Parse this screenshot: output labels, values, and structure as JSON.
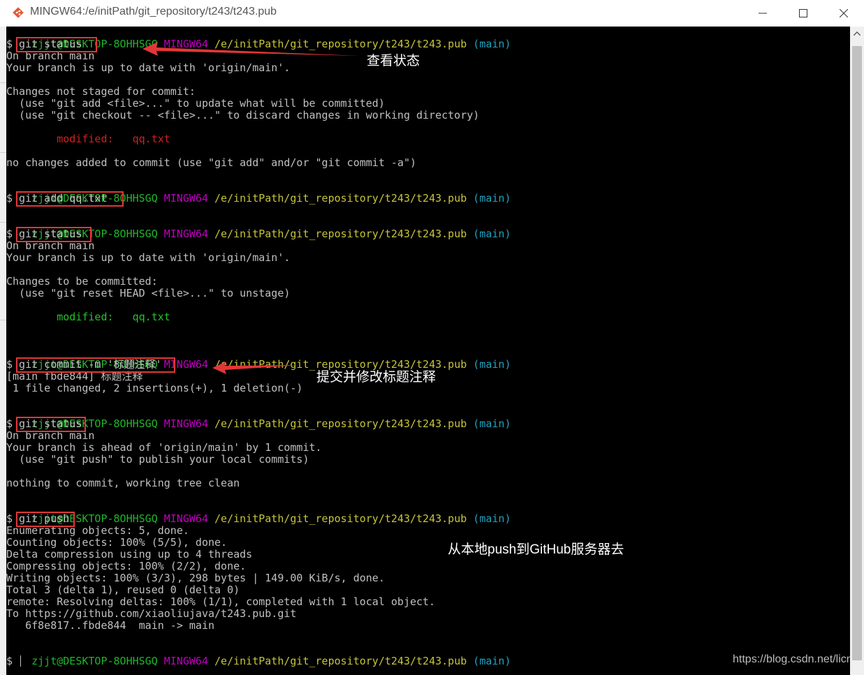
{
  "window": {
    "title": "MINGW64:/e/initPath/git_repository/t243/t243.pub",
    "buttons": [
      "minimize",
      "maximize",
      "close"
    ]
  },
  "prompt": {
    "user_host": "zjjt@DESKTOP-8OHHSGQ",
    "shell": "MINGW64",
    "path": "/e/initPath/git_repository/t243/t243.pub",
    "branch": "(main)"
  },
  "terminal": {
    "cmd1": "$ git status",
    "out1": [
      "On branch main",
      "Your branch is up to date with 'origin/main'.",
      "",
      "Changes not staged for commit:",
      "  (use \"git add <file>...\" to update what will be committed)",
      "  (use \"git checkout -- <file>...\" to discard changes in working directory)",
      ""
    ],
    "mod1_label": "        modified:   ",
    "mod1_file": "qq.txt",
    "out1b": "no changes added to commit (use \"git add\" and/or \"git commit -a\")",
    "cmd2": "$ git add qq.txt",
    "cmd3": "$ git status",
    "out3": [
      "On branch main",
      "Your branch is up to date with 'origin/main'.",
      "",
      "Changes to be committed:",
      "  (use \"git reset HEAD <file>...\" to unstage)"
    ],
    "mod3_label": "        modified:   ",
    "mod3_file": "qq.txt",
    "cmd4": "$ git commit -m '标题注释'",
    "out4": [
      "[main fbde844] 标题注释",
      " 1 file changed, 2 insertions(+), 1 deletion(-)"
    ],
    "cmd5": "$ git status",
    "out5": [
      "On branch main",
      "Your branch is ahead of 'origin/main' by 1 commit.",
      "  (use \"git push\" to publish your local commits)",
      "",
      "nothing to commit, working tree clean"
    ],
    "cmd6": "$ git push",
    "out6": [
      "Enumerating objects: 5, done.",
      "Counting objects: 100% (5/5), done.",
      "Delta compression using up to 4 threads",
      "Compressing objects: 100% (2/2), done.",
      "Writing objects: 100% (3/3), 298 bytes | 149.00 KiB/s, done.",
      "Total 3 (delta 1), reused 0 (delta 0)",
      "remote: Resolving deltas: 100% (1/1), completed with 1 local object.",
      "To https://github.com/xiaoliujava/t243.pub.git",
      "   6f8e817..fbde844  main -> main"
    ],
    "final_prompt": "$"
  },
  "annotations": {
    "status": "查看状态",
    "commit": "提交并修改标题注释",
    "push": "从本地push到GitHub服务器去"
  },
  "watermark": "https://blog.csdn.net/licn",
  "colors": {
    "background": "#000000",
    "text": "#c0c0c0",
    "user_host": "#1fb62a",
    "shell": "#c000c0",
    "path": "#c7c43b",
    "branch": "#1fa3bf",
    "unstaged": "#d61e1e",
    "staged": "#23c327",
    "highlight": "#e23737"
  }
}
